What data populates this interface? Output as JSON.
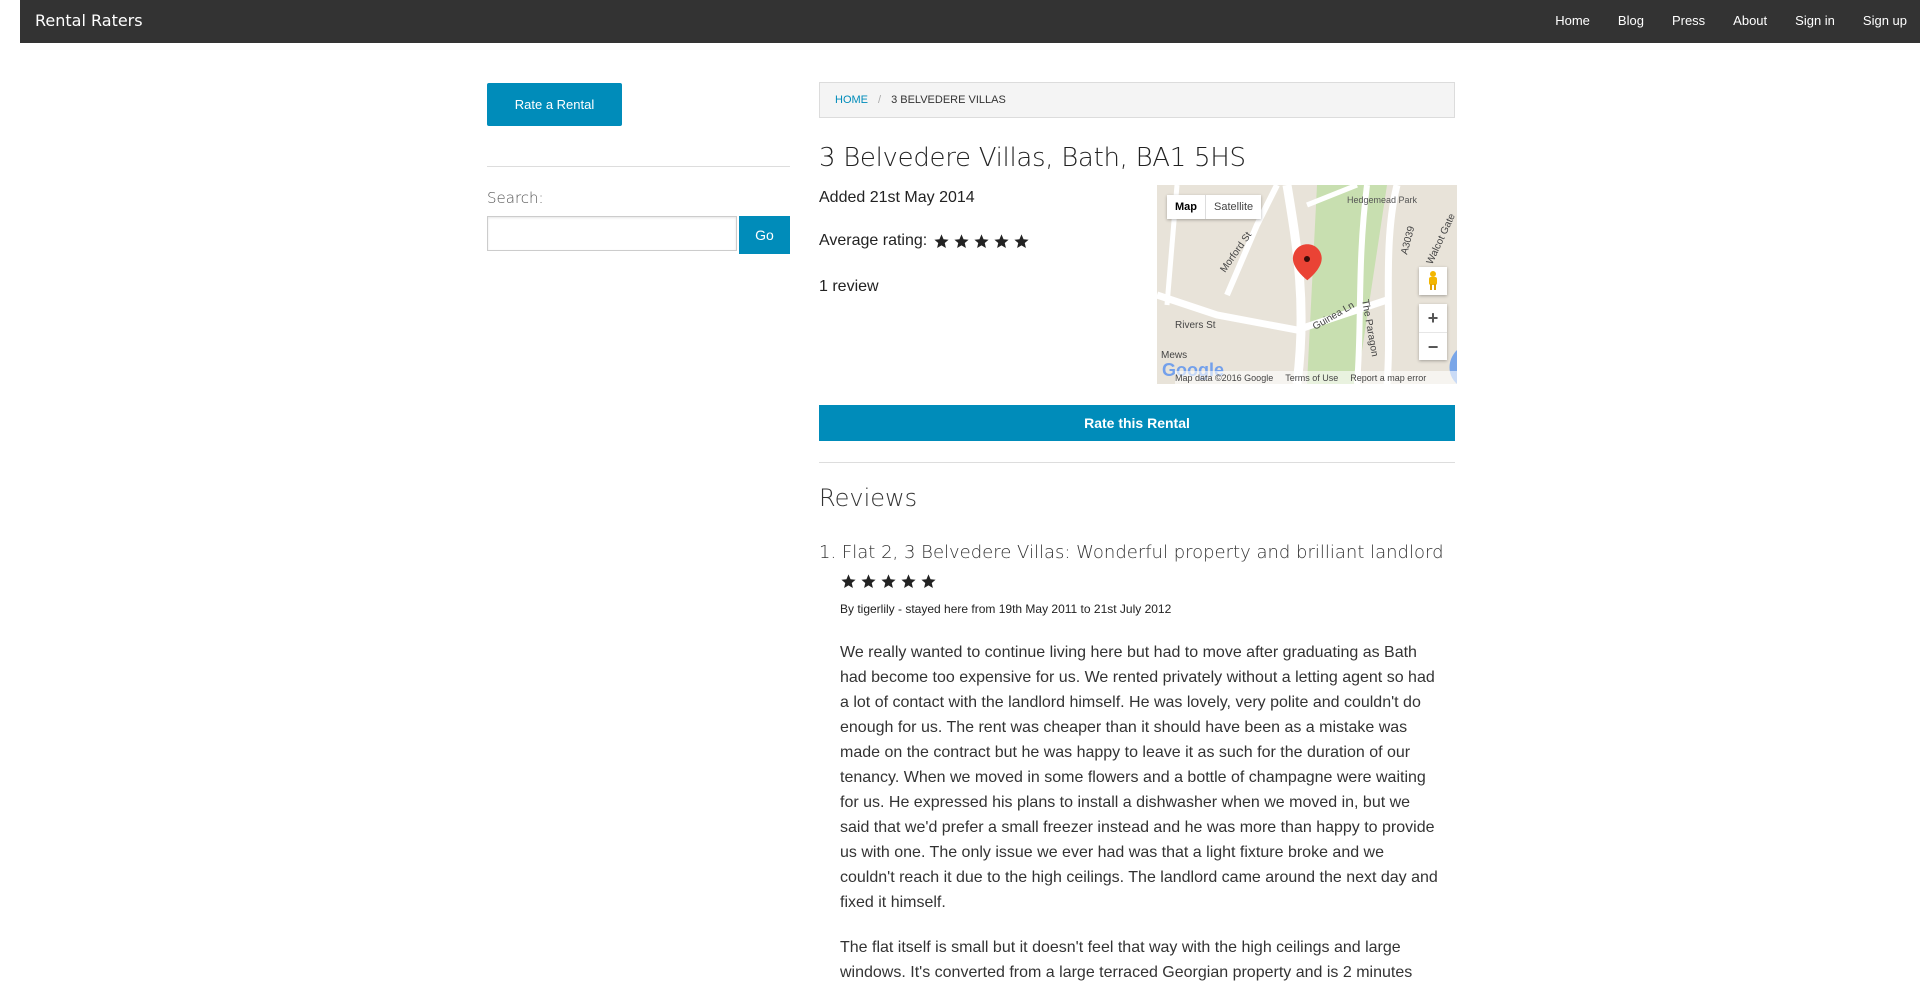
{
  "header": {
    "brand": "Rental Raters",
    "nav": [
      "Home",
      "Blog",
      "Press",
      "About",
      "Sign in",
      "Sign up"
    ]
  },
  "sidebar": {
    "rate_button": "Rate a Rental",
    "search_label": "Search:",
    "search_value": "",
    "go_button": "Go"
  },
  "breadcrumb": {
    "home": "HOME",
    "separator": "/",
    "current": "3 BELVEDERE VILLAS"
  },
  "property": {
    "title": "3 Belvedere Villas, Bath, BA1 5HS",
    "added": "Added 21st May 2014",
    "average_label": "Average rating:",
    "average_stars": 5,
    "review_count": "1 review",
    "rate_button": "Rate this Rental"
  },
  "map": {
    "type_map": "Map",
    "type_satellite": "Satellite",
    "zoom_in": "+",
    "zoom_out": "−",
    "attribution": "Map data ©2016 Google",
    "terms": "Terms of Use",
    "report": "Report a map error",
    "street_labels": [
      "Morford St",
      "Hedgemead Park",
      "A3039",
      "Walcot Gate",
      "Guinea Ln",
      "Rivers St",
      "The Paragon",
      "Mews"
    ],
    "colors": {
      "road": "#ffffff",
      "land": "#e8e3d9",
      "park": "#c8dfb0",
      "pin": "#ea4335"
    }
  },
  "reviews": {
    "heading": "Reviews",
    "items": [
      {
        "number": "1.",
        "title": "Flat 2, 3 Belvedere Villas: Wonderful property and brilliant landlord",
        "stars": 5,
        "byline": "By tigerlily - stayed here from 19th May 2011 to 21st July 2012",
        "paragraphs": [
          "We really wanted to continue living here but had to move after graduating as Bath had become too expensive for us. We rented privately without a letting agent so had a lot of contact with the landlord himself. He was lovely, very polite and couldn't do enough for us. The rent was cheaper than it should have been as a mistake was made on the contract but he was happy to leave it as such for the duration of our tenancy. When we moved in some flowers and a bottle of champagne were waiting for us. He expressed his plans to install a dishwasher when we moved in, but we said that we'd prefer a small freezer instead and he was more than happy to provide us with one. The only issue we ever had was that a light fixture broke and we couldn't reach it due to the high ceilings. The landlord came around the next day and fixed it himself.",
          "The flat itself is small but it doesn't feel that way with the high ceilings and large windows. It's converted from a large terraced Georgian property and is 2 minutes"
        ]
      }
    ]
  },
  "colors": {
    "accent": "#008cba",
    "topbar": "#333333"
  }
}
